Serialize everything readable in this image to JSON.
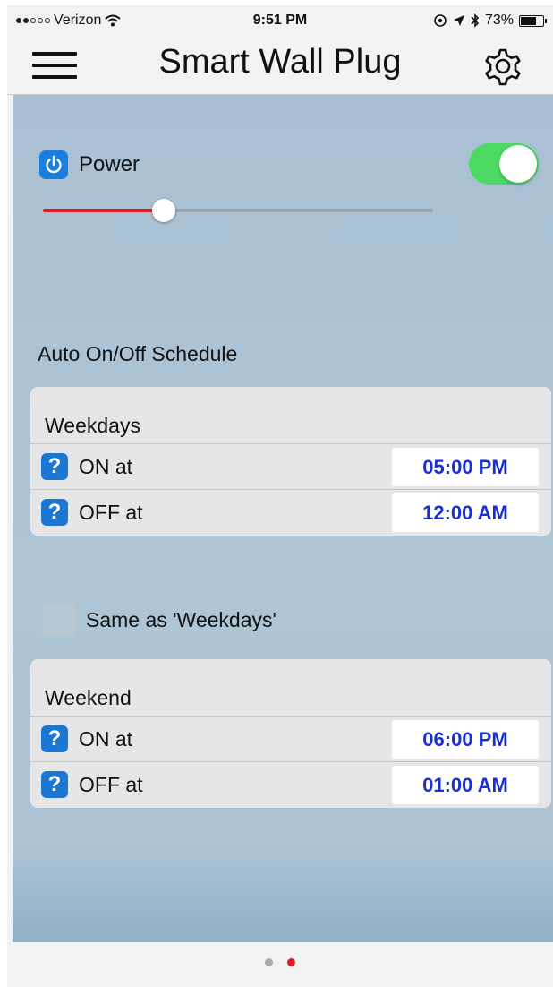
{
  "status_bar": {
    "carrier": "Verizon",
    "time": "9:51 PM",
    "battery": "73%",
    "battery_level": 0.73
  },
  "nav": {
    "title": "Smart Wall Plug",
    "menu_icon": "hamburger-icon",
    "settings_icon": "gear-icon"
  },
  "power": {
    "label": "Power",
    "on": true,
    "level": 0.31
  },
  "schedule": {
    "heading": "Auto On/Off Schedule",
    "weekdays": {
      "title": "Weekdays",
      "on_label": "ON at",
      "on_time": "05:00 PM",
      "off_label": "OFF at",
      "off_time": "12:00 AM"
    },
    "same_as": {
      "label": "Same as 'Weekdays'",
      "checked": false
    },
    "weekend": {
      "title": "Weekend",
      "on_label": "ON at",
      "on_time": "06:00 PM",
      "off_label": "OFF at",
      "off_time": "01:00 AM"
    }
  },
  "pager": {
    "count": 2,
    "active_index": 1
  },
  "colors": {
    "accent": "#4cd964",
    "slider": "#e01e26",
    "time_text": "#1a2fd0",
    "icon_blue": "#1b76d4"
  }
}
